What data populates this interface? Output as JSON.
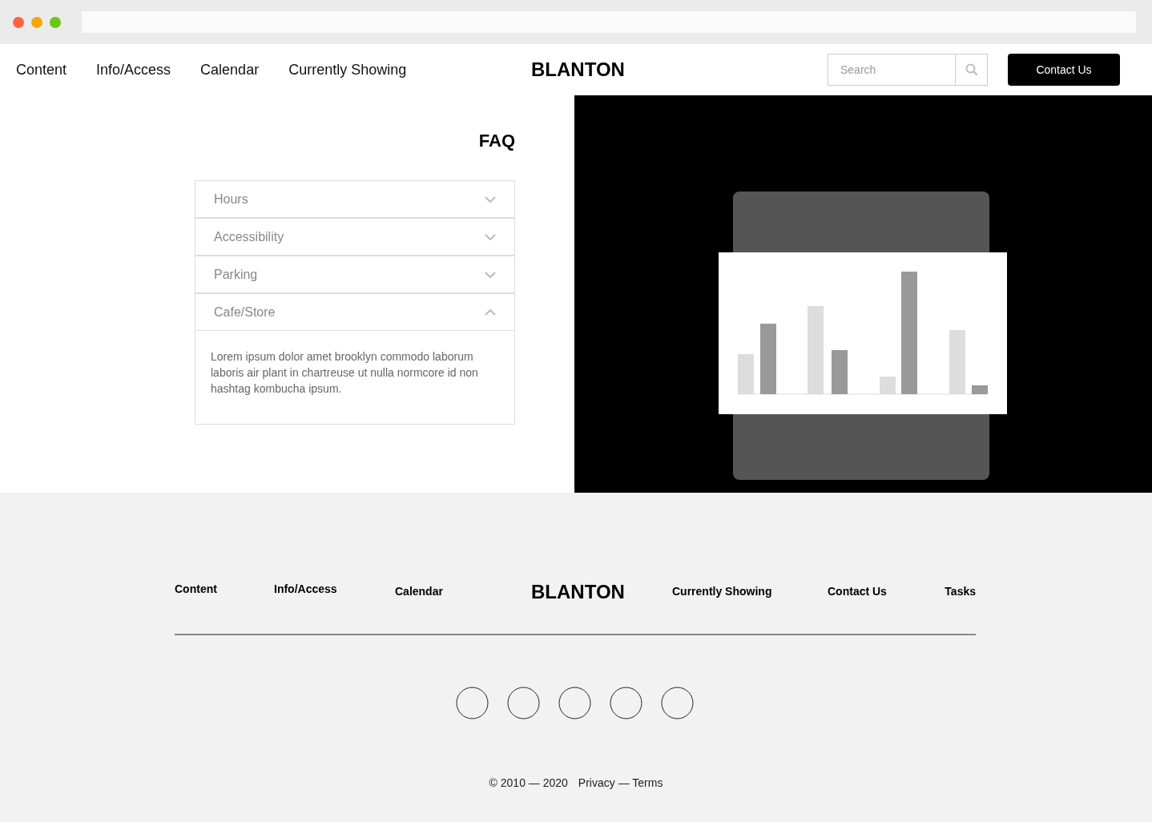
{
  "nav": {
    "links": [
      "Content",
      "Info/Access",
      "Calendar",
      "Currently Showing"
    ],
    "logo": "BLANTON",
    "search": {
      "placeholder": "Search"
    },
    "contact_button": "Contact Us"
  },
  "faq": {
    "title": "FAQ",
    "items": [
      {
        "label": "Hours",
        "expanded": false
      },
      {
        "label": "Accessibility",
        "expanded": false
      },
      {
        "label": "Parking",
        "expanded": false
      },
      {
        "label": "Cafe/Store",
        "expanded": true,
        "answer": "Lorem ipsum dolor amet brooklyn commodo laborum laboris air plant in chartreuse ut nulla normcore id non hashtag kombucha ipsum."
      }
    ]
  },
  "footer": {
    "links_left": [
      "Content",
      "Info/Access",
      "Calendar"
    ],
    "logo": "BLANTON",
    "links_right": [
      "Currently Showing",
      "Contact Us",
      "Tasks"
    ],
    "copyright": "© 2010 — 2020",
    "legal": "Privacy — Terms"
  }
}
